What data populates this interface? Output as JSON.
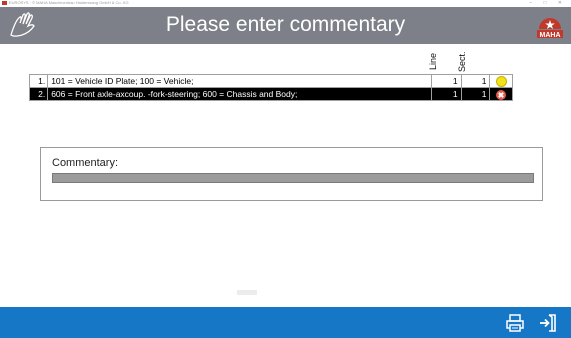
{
  "window": {
    "title": "EUROSYS · © MAHA Maschinenbau Haldenwang GmbH & Co. KG",
    "controls": "–  □  ✕"
  },
  "header": {
    "title": "Please enter commentary",
    "logo_icon": "hand-signature-icon",
    "brand_icon": "maha-logo-icon",
    "brand_color": "#c0392b",
    "bg_color": "#7d8088"
  },
  "table": {
    "columns": {
      "line": "Line",
      "sect": "Sect."
    },
    "rows": [
      {
        "num": "1.",
        "text": "101 = Vehicle ID Plate; 100 = Vehicle;",
        "line": "1",
        "sect": "1",
        "status": "yellow-circle-icon"
      },
      {
        "num": "2.",
        "text": "606 = Front axle-axcoup. -fork-steering; 600 = Chassis and Body;",
        "line": "1",
        "sect": "1",
        "status": "red-x-circle-icon"
      }
    ]
  },
  "commentary": {
    "label": "Commentary:",
    "value": ""
  },
  "footer": {
    "bg_color": "#1577c6",
    "print_icon": "printer-icon",
    "exit_icon": "exit-door-icon"
  }
}
